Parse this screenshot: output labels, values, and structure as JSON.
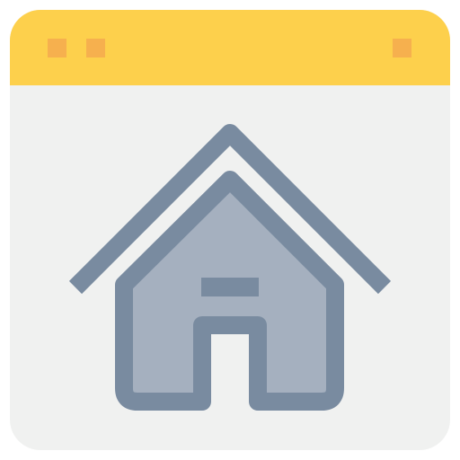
{
  "icon": {
    "name": "browser-home-icon",
    "description_icon": "home-icon"
  },
  "colors": {
    "titlebar": "#fdd04c",
    "titlebar_buttons": "#f6b04e",
    "window_body": "#f0f1f0",
    "house_fill": "#a5b0bf",
    "house_stroke": "#798ba0"
  }
}
